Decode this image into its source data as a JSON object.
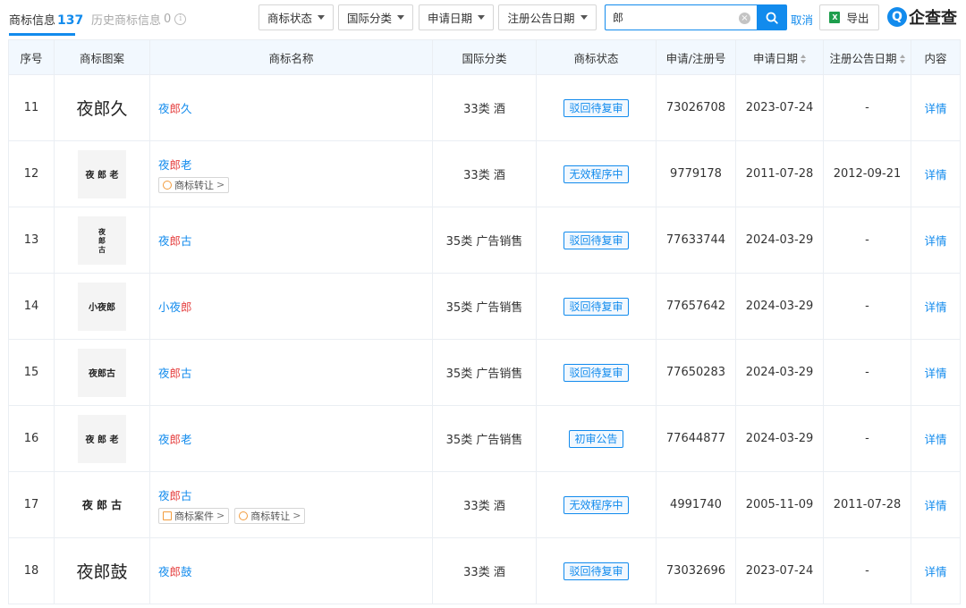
{
  "tabs": {
    "main_label": "商标信息",
    "main_count": "137",
    "history_label": "历史商标信息",
    "history_count": "0",
    "info_icon": "i"
  },
  "filters": {
    "status": "商标状态",
    "intl_class": "国际分类",
    "apply_date": "申请日期",
    "reg_date": "注册公告日期"
  },
  "search": {
    "value": "郎",
    "clear_icon": "×",
    "cancel_label": "取消"
  },
  "export": {
    "icon": "X",
    "label": "导出"
  },
  "logo": {
    "mark": "Q",
    "text": "企查查"
  },
  "table": {
    "headers": {
      "index": "序号",
      "image": "商标图案",
      "name": "商标名称",
      "class": "国际分类",
      "status": "商标状态",
      "reg_no": "申请/注册号",
      "apply_date": "申请日期",
      "reg_date": "注册公告日期",
      "content": "内容"
    },
    "rows": [
      {
        "index": "11",
        "image_text": "夜郎久",
        "image_style": "plain",
        "name_pre": "夜",
        "name_hl": "郎",
        "name_post": "久",
        "tags": [],
        "class": "33类 酒",
        "status": "驳回待复审",
        "reg_no": "73026708",
        "apply_date": "2023-07-24",
        "reg_date": "-",
        "detail": "详情"
      },
      {
        "index": "12",
        "image_text": "夜 郎 老",
        "image_style": "small",
        "name_pre": "夜",
        "name_hl": "郎",
        "name_post": "老",
        "tags": [
          {
            "icon": "◎",
            "label": "商标转让",
            "arrow": ">"
          }
        ],
        "class": "33类 酒",
        "status": "无效程序中",
        "reg_no": "9779178",
        "apply_date": "2011-07-28",
        "reg_date": "2012-09-21",
        "detail": "详情"
      },
      {
        "index": "13",
        "image_text": "夜郎古",
        "image_style": "vert",
        "name_pre": "夜",
        "name_hl": "郎",
        "name_post": "古",
        "tags": [],
        "class": "35类 广告销售",
        "status": "驳回待复审",
        "reg_no": "77633744",
        "apply_date": "2024-03-29",
        "reg_date": "-",
        "detail": "详情"
      },
      {
        "index": "14",
        "image_text": "小夜郎",
        "image_style": "small",
        "name_pre": "小夜",
        "name_hl": "郎",
        "name_post": "",
        "tags": [],
        "class": "35类 广告销售",
        "status": "驳回待复审",
        "reg_no": "77657642",
        "apply_date": "2024-03-29",
        "reg_date": "-",
        "detail": "详情"
      },
      {
        "index": "15",
        "image_text": "夜郎古",
        "image_style": "small",
        "name_pre": "夜",
        "name_hl": "郎",
        "name_post": "古",
        "tags": [],
        "class": "35类 广告销售",
        "status": "驳回待复审",
        "reg_no": "77650283",
        "apply_date": "2024-03-29",
        "reg_date": "-",
        "detail": "详情"
      },
      {
        "index": "16",
        "image_text": "夜 郎 老",
        "image_style": "small",
        "name_pre": "夜",
        "name_hl": "郎",
        "name_post": "老",
        "tags": [],
        "class": "35类 广告销售",
        "status": "初审公告",
        "reg_no": "77644877",
        "apply_date": "2024-03-29",
        "reg_date": "-",
        "detail": "详情"
      },
      {
        "index": "17",
        "image_text": "夜 郎 古",
        "image_style": "plain-small",
        "name_pre": "夜",
        "name_hl": "郎",
        "name_post": "古",
        "tags": [
          {
            "icon": "▣",
            "label": "商标案件",
            "arrow": ">"
          },
          {
            "icon": "◎",
            "label": "商标转让",
            "arrow": ">"
          }
        ],
        "class": "33类 酒",
        "status": "无效程序中",
        "reg_no": "4991740",
        "apply_date": "2005-11-09",
        "reg_date": "2011-07-28",
        "detail": "详情"
      },
      {
        "index": "18",
        "image_text": "夜郎鼓",
        "image_style": "plain",
        "name_pre": "夜",
        "name_hl": "郎",
        "name_post": "鼓",
        "tags": [],
        "class": "33类 酒",
        "status": "驳回待复审",
        "reg_no": "73032696",
        "apply_date": "2023-07-24",
        "reg_date": "-",
        "detail": "详情"
      }
    ]
  },
  "colors": {
    "accent": "#128bed",
    "highlight": "#e54545",
    "header_bg": "#f2f8fe",
    "border": "#eaeef3"
  }
}
